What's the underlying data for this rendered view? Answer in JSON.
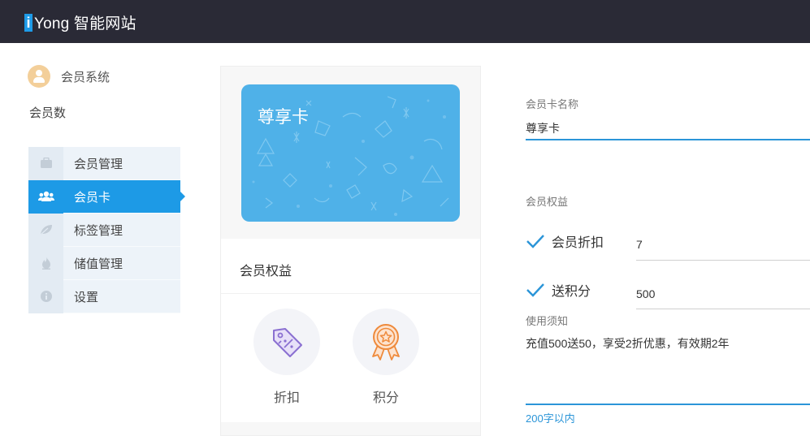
{
  "brand": {
    "logo_mark": "i",
    "logo_text": "Yong 智能网站"
  },
  "sidebar": {
    "user_label": "会员系统",
    "member_count_label": "会员数",
    "items": [
      {
        "label": "会员管理",
        "icon": "briefcase-icon",
        "active": false
      },
      {
        "label": "会员卡",
        "icon": "users-icon",
        "active": true
      },
      {
        "label": "标签管理",
        "icon": "leaf-icon",
        "active": false
      },
      {
        "label": "储值管理",
        "icon": "flame-icon",
        "active": false
      },
      {
        "label": "设置",
        "icon": "info-icon",
        "active": false
      }
    ]
  },
  "preview": {
    "card_name": "尊享卡",
    "benefits_title": "会员权益",
    "benefits": [
      {
        "label": "折扣",
        "icon": "discount-tag-icon"
      },
      {
        "label": "积分",
        "icon": "points-medal-icon"
      }
    ]
  },
  "form": {
    "card_name_label": "会员卡名称",
    "card_name_value": "尊享卡",
    "rights_label": "会员权益",
    "discount_label": "会员折扣",
    "discount_value": "7",
    "points_label": "送积分",
    "points_value": "500",
    "notice_label": "使用须知",
    "notice_value": "充值500送50，享受2折优惠，有效期2年",
    "notice_counter": "200字以内"
  },
  "colors": {
    "topbar": "#2a2a36",
    "accent": "#1d9ae6",
    "card": "#4fb1e8",
    "discount_icon": "#8a6fd1",
    "points_icon": "#ee8a3c"
  }
}
